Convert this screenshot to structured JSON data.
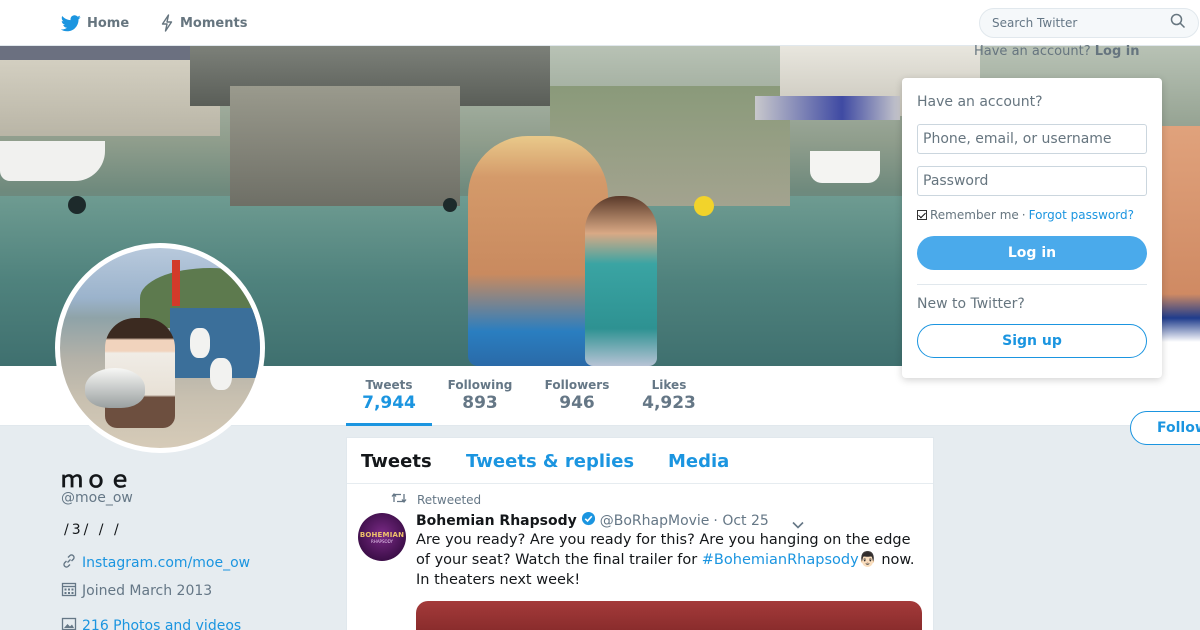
{
  "nav": {
    "home_label": "Home",
    "moments_label": "Moments",
    "search_placeholder": "Search Twitter"
  },
  "login": {
    "trigger_text": "Have an account?",
    "trigger_action": "Log in",
    "heading": "Have an account?",
    "username_placeholder": "Phone, email, or username",
    "password_placeholder": "Password",
    "remember_label": "Remember me",
    "separator": "·",
    "forgot_label": "Forgot password?",
    "login_button": "Log in",
    "new_heading": "New to Twitter?",
    "signup_button": "Sign up"
  },
  "profile": {
    "name": "ｍｏｅ",
    "handle": "@moe_ow",
    "bio": "/3/ / /",
    "link": "Instagram.com/moe_ow",
    "joined": "Joined March 2013",
    "photos": "216 Photos and videos",
    "follow_button": "Follow"
  },
  "stats": [
    {
      "label": "Tweets",
      "value": "7,944",
      "active": true
    },
    {
      "label": "Following",
      "value": "893",
      "active": false
    },
    {
      "label": "Followers",
      "value": "946",
      "active": false
    },
    {
      "label": "Likes",
      "value": "4,923",
      "active": false
    }
  ],
  "tabs": [
    {
      "label": "Tweets",
      "active": true
    },
    {
      "label": "Tweets & replies",
      "active": false
    },
    {
      "label": "Media",
      "active": false
    }
  ],
  "tweet": {
    "retweet_label": "Retweeted",
    "author_name": "Bohemian Rhapsody",
    "author_handle": "@BoRhapMovie",
    "date": "· Oct 25",
    "avatar_text_1": "BOHEMIAN",
    "avatar_text_2": "RHAPSODY",
    "text_before": "Are you ready? Are you ready for this? Are you hanging on the edge of your seat? Watch the final trailer for ",
    "hashtag": "#BohemianRhapsody",
    "emoji": "👨🏻",
    "text_after": " now. In theaters next week!"
  },
  "colors": {
    "accent": "#1b95e0",
    "login_button": "#4aaaeb",
    "background": "#e6ecf0"
  },
  "icons": {
    "home": "twitter-bird-icon",
    "moments": "lightning-icon",
    "search": "search-icon",
    "retweet": "retweet-icon",
    "verified": "verified-icon",
    "caret": "chevron-down-icon",
    "link": "link-icon",
    "calendar": "calendar-icon",
    "photos": "image-icon"
  }
}
